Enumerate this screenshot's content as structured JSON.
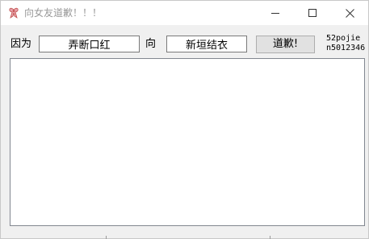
{
  "window": {
    "title": "向女友道歉！！！",
    "icon": "app-ribbon-icon",
    "controls": {
      "minimize_icon": "minimize-icon",
      "maximize_icon": "maximize-icon",
      "close_icon": "close-icon"
    }
  },
  "form": {
    "because_label": "因为",
    "reason_value": "弄断口红",
    "to_label": "向",
    "target_value": "新垣结衣",
    "apologize_label": "道歉!"
  },
  "credit": {
    "line1": "52pojie",
    "line2": "n5012346"
  },
  "output": {
    "value": ""
  },
  "colors": {
    "window_bg": "#f0f0f0",
    "title_text": "#999999",
    "button_bg": "#e1e1e1",
    "icon_pink": "#d9534f"
  }
}
